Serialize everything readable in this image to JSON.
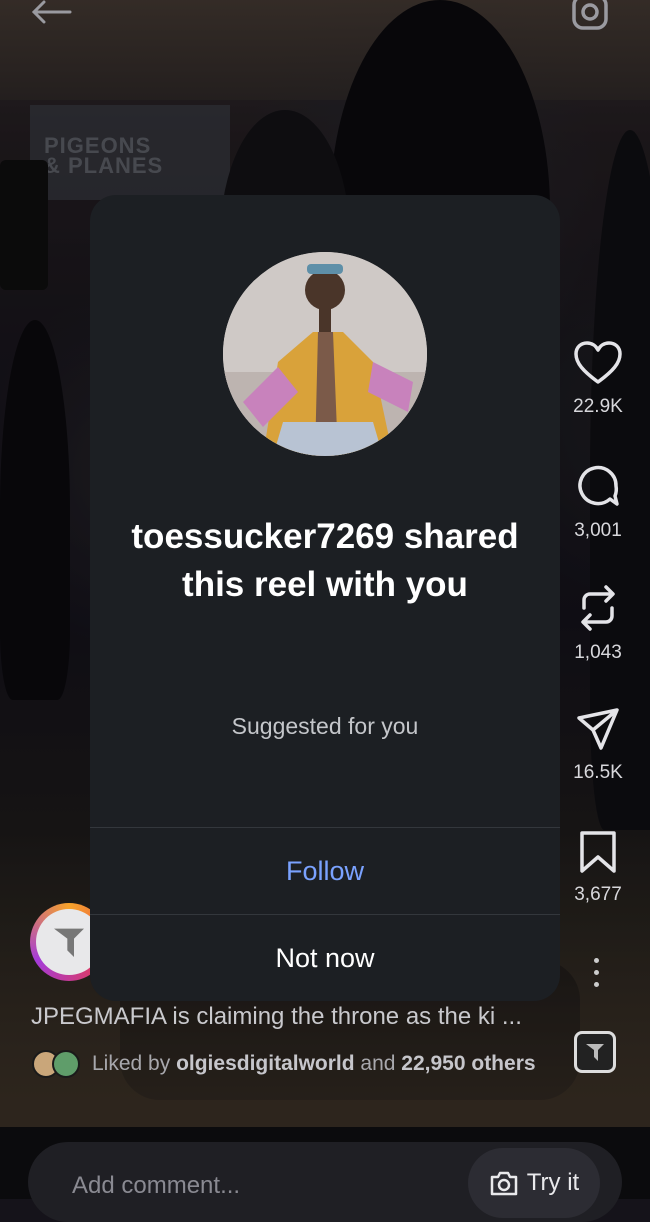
{
  "background": {
    "brand_watermark": "PIGEONS & PLANES"
  },
  "modal": {
    "title": "toessucker7269 shared this reel with you",
    "subtitle": "Suggested for you",
    "follow_label": "Follow",
    "not_now_label": "Not now",
    "follow_color": "#7aa2ff",
    "background_color": "#1c1f23"
  },
  "actions": {
    "likes_count": "22.9K",
    "comments_count": "3,001",
    "reposts_count": "1,043",
    "shares_count": "16.5K",
    "saves_count": "3,677"
  },
  "post": {
    "caption": "JPEGMAFIA is claiming the throne as the ki ...",
    "liked_by_prefix": "Liked by ",
    "liked_by_user": "olgiesdigitalworld",
    "liked_by_mid": " and ",
    "liked_by_count": "22,950 others"
  },
  "comment_bar": {
    "placeholder": "Add comment...",
    "try_it_label": "Try it"
  },
  "icons": [
    "back-arrow-icon",
    "camera-icon",
    "heart-icon",
    "comment-icon",
    "repost-icon",
    "send-icon",
    "bookmark-icon",
    "more-icon",
    "audio-icon"
  ]
}
